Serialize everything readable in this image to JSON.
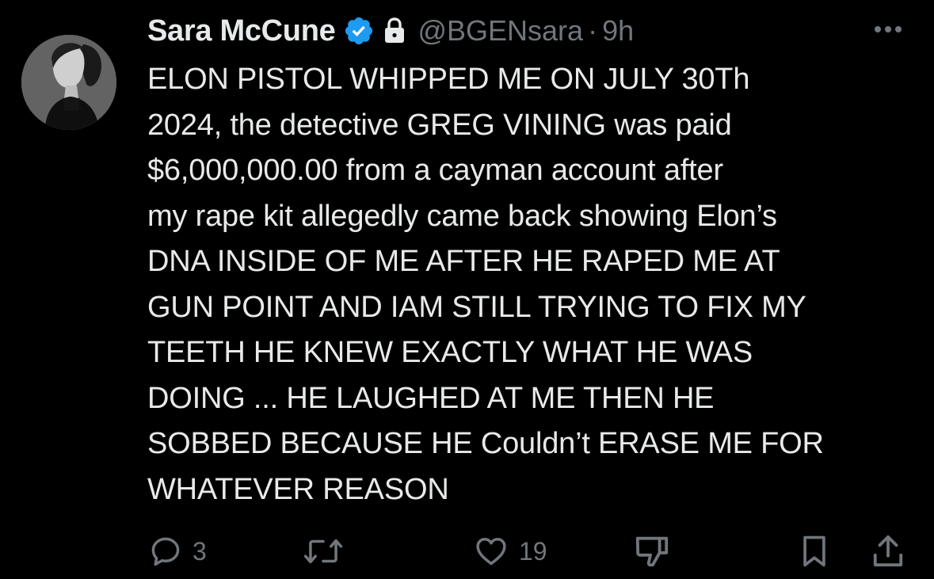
{
  "tweet": {
    "author_name": "Sara McCune",
    "handle": "@BGENsara",
    "separator": "·",
    "time": "9h",
    "text": "ELON PISTOL WHIPPED ME ON JULY 30Th\n2024, the detective GREG VINING was paid\n$6,000,000.00 from a cayman account after\nmy rape kit allegedly came back showing Elon’s\nDNA INSIDE OF ME AFTER HE RAPED ME AT\nGUN POINT AND IAM STILL TRYING TO FIX MY\nTEETH HE KNEW EXACTLY WHAT HE WAS\nDOING ... HE LAUGHED AT ME THEN HE\nSOBBED BECAUSE HE Couldn’t ERASE ME FOR\nWHATEVER REASON"
  },
  "actions": {
    "reply_count": "3",
    "like_count": "19"
  },
  "icons": {
    "verified": "verified-badge-icon",
    "protected": "lock-icon",
    "more": "more-dots-icon",
    "reply": "reply-icon",
    "retweet": "retweet-icon",
    "like": "heart-icon",
    "dislike": "thumbs-down-icon",
    "bookmark": "bookmark-icon",
    "share": "share-icon"
  },
  "colors": {
    "background": "#000000",
    "text": "#e7e9ea",
    "muted": "#71767b",
    "verified_blue": "#1d9bf0"
  }
}
